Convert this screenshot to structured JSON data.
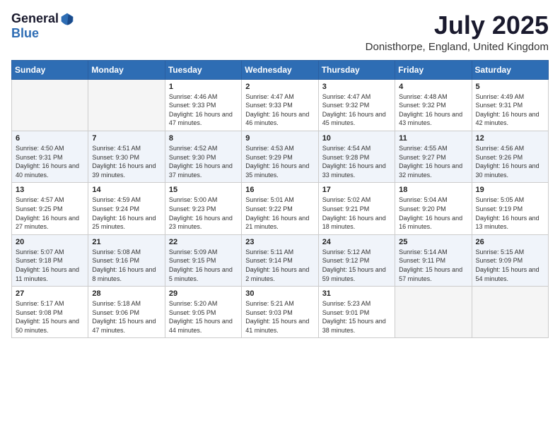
{
  "logo": {
    "general": "General",
    "blue": "Blue"
  },
  "title": {
    "month": "July 2025",
    "location": "Donisthorpe, England, United Kingdom"
  },
  "headers": [
    "Sunday",
    "Monday",
    "Tuesday",
    "Wednesday",
    "Thursday",
    "Friday",
    "Saturday"
  ],
  "weeks": [
    [
      {
        "day": "",
        "info": ""
      },
      {
        "day": "",
        "info": ""
      },
      {
        "day": "1",
        "info": "Sunrise: 4:46 AM\nSunset: 9:33 PM\nDaylight: 16 hours and 47 minutes."
      },
      {
        "day": "2",
        "info": "Sunrise: 4:47 AM\nSunset: 9:33 PM\nDaylight: 16 hours and 46 minutes."
      },
      {
        "day": "3",
        "info": "Sunrise: 4:47 AM\nSunset: 9:32 PM\nDaylight: 16 hours and 45 minutes."
      },
      {
        "day": "4",
        "info": "Sunrise: 4:48 AM\nSunset: 9:32 PM\nDaylight: 16 hours and 43 minutes."
      },
      {
        "day": "5",
        "info": "Sunrise: 4:49 AM\nSunset: 9:31 PM\nDaylight: 16 hours and 42 minutes."
      }
    ],
    [
      {
        "day": "6",
        "info": "Sunrise: 4:50 AM\nSunset: 9:31 PM\nDaylight: 16 hours and 40 minutes."
      },
      {
        "day": "7",
        "info": "Sunrise: 4:51 AM\nSunset: 9:30 PM\nDaylight: 16 hours and 39 minutes."
      },
      {
        "day": "8",
        "info": "Sunrise: 4:52 AM\nSunset: 9:30 PM\nDaylight: 16 hours and 37 minutes."
      },
      {
        "day": "9",
        "info": "Sunrise: 4:53 AM\nSunset: 9:29 PM\nDaylight: 16 hours and 35 minutes."
      },
      {
        "day": "10",
        "info": "Sunrise: 4:54 AM\nSunset: 9:28 PM\nDaylight: 16 hours and 33 minutes."
      },
      {
        "day": "11",
        "info": "Sunrise: 4:55 AM\nSunset: 9:27 PM\nDaylight: 16 hours and 32 minutes."
      },
      {
        "day": "12",
        "info": "Sunrise: 4:56 AM\nSunset: 9:26 PM\nDaylight: 16 hours and 30 minutes."
      }
    ],
    [
      {
        "day": "13",
        "info": "Sunrise: 4:57 AM\nSunset: 9:25 PM\nDaylight: 16 hours and 27 minutes."
      },
      {
        "day": "14",
        "info": "Sunrise: 4:59 AM\nSunset: 9:24 PM\nDaylight: 16 hours and 25 minutes."
      },
      {
        "day": "15",
        "info": "Sunrise: 5:00 AM\nSunset: 9:23 PM\nDaylight: 16 hours and 23 minutes."
      },
      {
        "day": "16",
        "info": "Sunrise: 5:01 AM\nSunset: 9:22 PM\nDaylight: 16 hours and 21 minutes."
      },
      {
        "day": "17",
        "info": "Sunrise: 5:02 AM\nSunset: 9:21 PM\nDaylight: 16 hours and 18 minutes."
      },
      {
        "day": "18",
        "info": "Sunrise: 5:04 AM\nSunset: 9:20 PM\nDaylight: 16 hours and 16 minutes."
      },
      {
        "day": "19",
        "info": "Sunrise: 5:05 AM\nSunset: 9:19 PM\nDaylight: 16 hours and 13 minutes."
      }
    ],
    [
      {
        "day": "20",
        "info": "Sunrise: 5:07 AM\nSunset: 9:18 PM\nDaylight: 16 hours and 11 minutes."
      },
      {
        "day": "21",
        "info": "Sunrise: 5:08 AM\nSunset: 9:16 PM\nDaylight: 16 hours and 8 minutes."
      },
      {
        "day": "22",
        "info": "Sunrise: 5:09 AM\nSunset: 9:15 PM\nDaylight: 16 hours and 5 minutes."
      },
      {
        "day": "23",
        "info": "Sunrise: 5:11 AM\nSunset: 9:14 PM\nDaylight: 16 hours and 2 minutes."
      },
      {
        "day": "24",
        "info": "Sunrise: 5:12 AM\nSunset: 9:12 PM\nDaylight: 15 hours and 59 minutes."
      },
      {
        "day": "25",
        "info": "Sunrise: 5:14 AM\nSunset: 9:11 PM\nDaylight: 15 hours and 57 minutes."
      },
      {
        "day": "26",
        "info": "Sunrise: 5:15 AM\nSunset: 9:09 PM\nDaylight: 15 hours and 54 minutes."
      }
    ],
    [
      {
        "day": "27",
        "info": "Sunrise: 5:17 AM\nSunset: 9:08 PM\nDaylight: 15 hours and 50 minutes."
      },
      {
        "day": "28",
        "info": "Sunrise: 5:18 AM\nSunset: 9:06 PM\nDaylight: 15 hours and 47 minutes."
      },
      {
        "day": "29",
        "info": "Sunrise: 5:20 AM\nSunset: 9:05 PM\nDaylight: 15 hours and 44 minutes."
      },
      {
        "day": "30",
        "info": "Sunrise: 5:21 AM\nSunset: 9:03 PM\nDaylight: 15 hours and 41 minutes."
      },
      {
        "day": "31",
        "info": "Sunrise: 5:23 AM\nSunset: 9:01 PM\nDaylight: 15 hours and 38 minutes."
      },
      {
        "day": "",
        "info": ""
      },
      {
        "day": "",
        "info": ""
      }
    ]
  ]
}
